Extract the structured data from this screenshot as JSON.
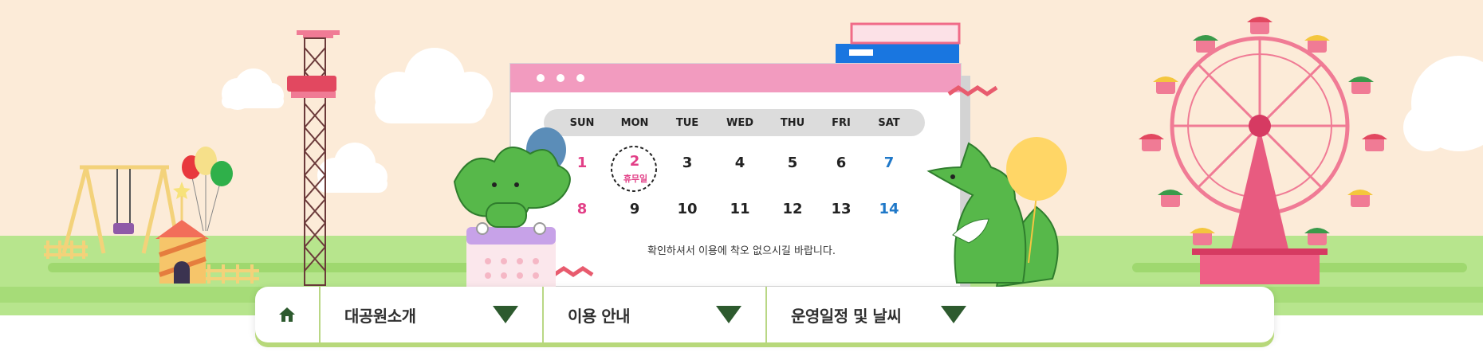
{
  "calendar": {
    "days_of_week": [
      "SUN",
      "MON",
      "TUE",
      "WED",
      "THU",
      "FRI",
      "SAT"
    ],
    "week1": [
      "1",
      "2",
      "3",
      "4",
      "5",
      "6",
      "7"
    ],
    "week2": [
      "8",
      "9",
      "10",
      "11",
      "12",
      "13",
      "14"
    ],
    "holiday_label": "휴무일",
    "notice": "확인하셔서 이용에 착오 없으시길 바랍니다."
  },
  "nav": {
    "items": [
      {
        "label": "대공원소개",
        "icon": "chevron-down-icon"
      },
      {
        "label": "이용 안내",
        "icon": "chevron-down-icon"
      },
      {
        "label": "운영일정 및 날씨",
        "icon": "chevron-down-icon"
      }
    ],
    "home_icon": "home-icon"
  },
  "colors": {
    "sky": "#fcebd8",
    "grass_light": "#b7e58d",
    "grass_dark": "#8bd16a",
    "calendar_header": "#f29bbf",
    "accent_pink": "#e23f87",
    "accent_blue": "#1f78c8",
    "nav_divider": "#b9d785",
    "chevron": "#2d5a2e"
  }
}
